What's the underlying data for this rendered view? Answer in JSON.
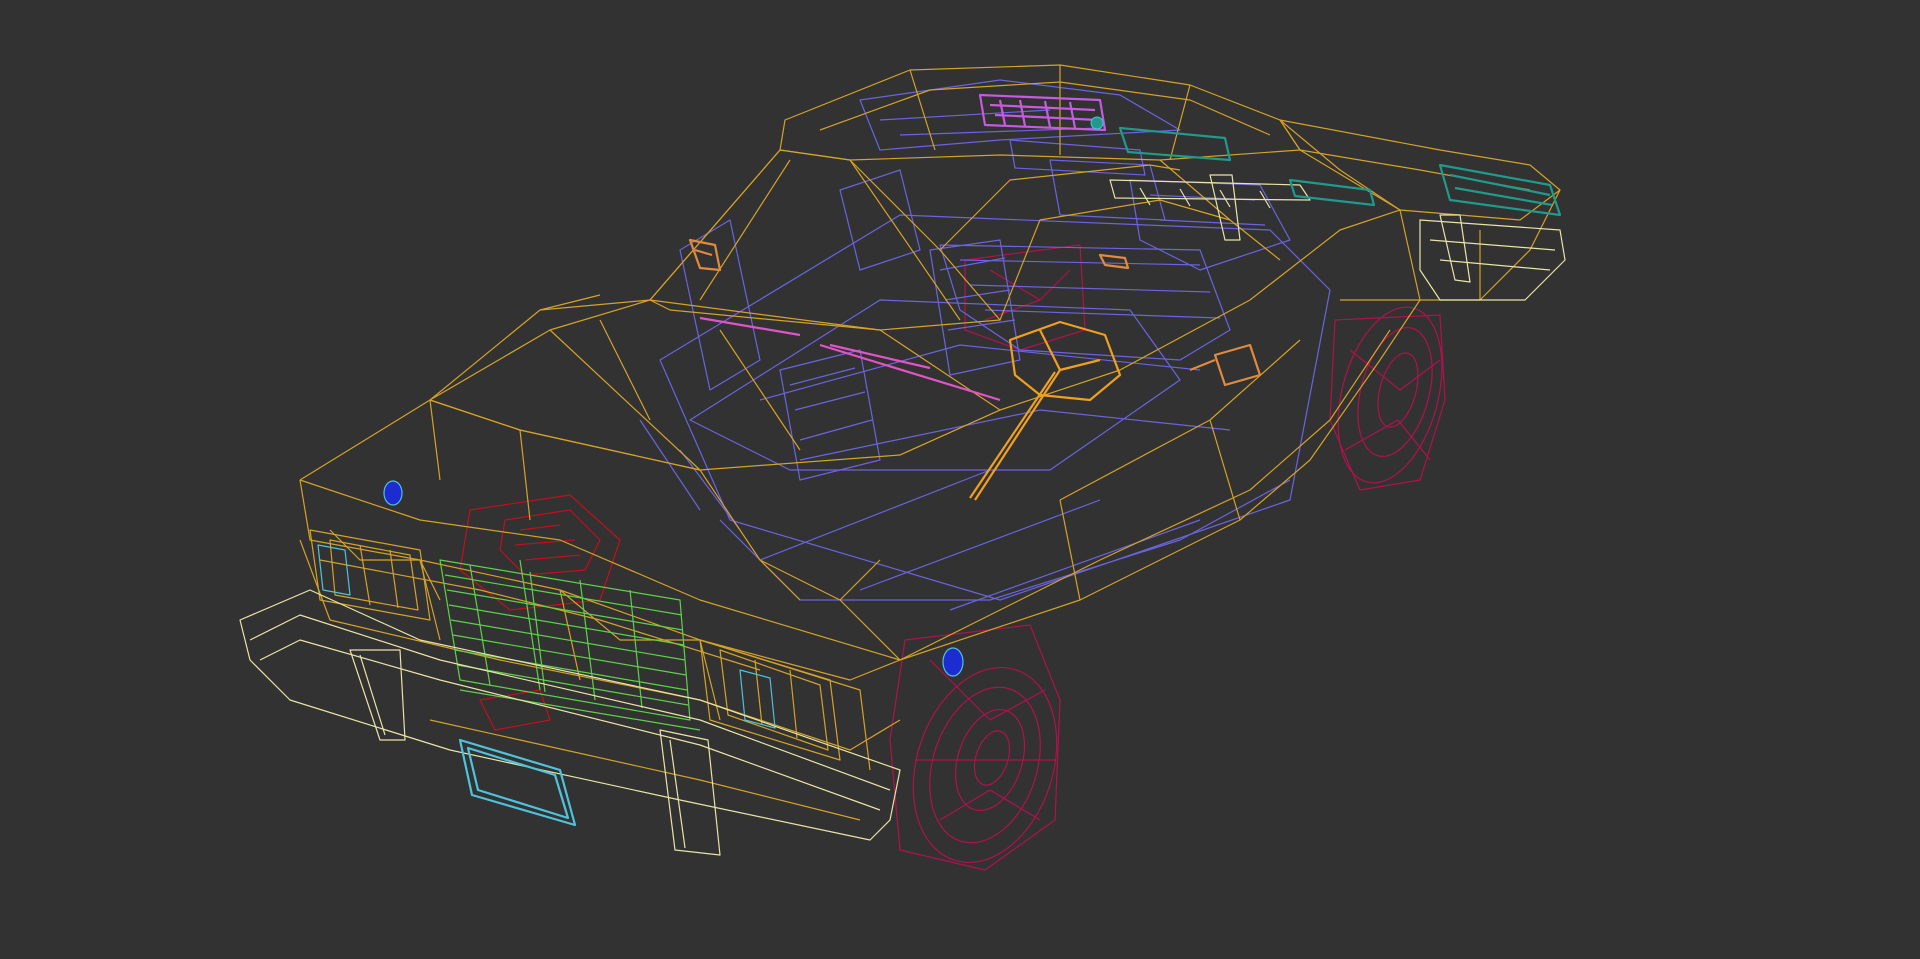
{
  "viewport": {
    "mode": "wireframe",
    "background_color": "#323232"
  },
  "model": {
    "subject": "car",
    "parts": [
      {
        "part": "body-shell",
        "color": "#d4a229"
      },
      {
        "part": "bumpers",
        "color": "#e8e4a6"
      },
      {
        "part": "interior",
        "color": "#6b63e0"
      },
      {
        "part": "wheels",
        "color": "#b0124c"
      },
      {
        "part": "grille",
        "color": "#5ed14c"
      },
      {
        "part": "license-plate",
        "color": "#4fc2dc"
      },
      {
        "part": "light-bar",
        "color": "#c65ae0"
      },
      {
        "part": "rear-lights",
        "color": "#1f9a8c"
      },
      {
        "part": "mirrors",
        "color": "#e08a40"
      },
      {
        "part": "wipers",
        "color": "#e054c8"
      },
      {
        "part": "steering-wheel",
        "color": "#f0a020"
      },
      {
        "part": "engine-block",
        "color": "#c0101c"
      },
      {
        "part": "emblems",
        "color": "#1c2cd0"
      }
    ]
  }
}
